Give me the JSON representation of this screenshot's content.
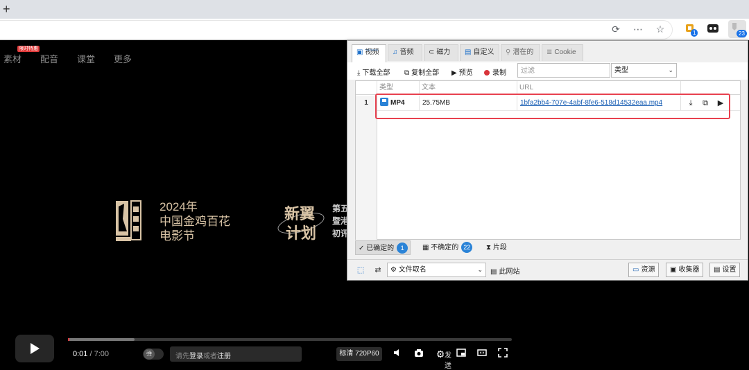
{
  "browser": {
    "newtab_glyph": "+",
    "ext_badge_1": "1",
    "ext_badge_2": "23"
  },
  "site": {
    "nav": [
      {
        "label": "素材",
        "hot": "限时特惠"
      },
      {
        "label": "配音"
      },
      {
        "label": "课堂"
      },
      {
        "label": "更多"
      }
    ],
    "hero_line1": "2024年",
    "hero_line2": "中国金鸡百花",
    "hero_line3": "电影节",
    "hero_side": "第五\n暨港\n初评"
  },
  "player": {
    "time_current": "0:01",
    "time_total": " / 7:00",
    "danmu_label": "弹",
    "comment_prefix": "请先",
    "comment_login": "登录",
    "comment_or": "或者",
    "comment_register": "注册",
    "send_label": "发送",
    "quality_label": "标清 720P60",
    "progress_played": 0.003,
    "progress_buffered": 0.15
  },
  "popup": {
    "tabs": [
      {
        "label": "视频",
        "icon": "save-icon",
        "glyph": "💾"
      },
      {
        "label": "音频",
        "icon": "music-icon",
        "glyph": "♫"
      },
      {
        "label": "磁力",
        "icon": "magnet-icon",
        "glyph": "⊂"
      },
      {
        "label": "自定义",
        "icon": "custom-icon",
        "glyph": "▤"
      },
      {
        "label": "潜在的",
        "icon": "potential-icon",
        "glyph": "⚲"
      },
      {
        "label": "Cookie",
        "icon": "cookie-icon",
        "glyph": "≣"
      }
    ],
    "actions": {
      "download_all": "下载全部",
      "copy_all": "复制全部",
      "preview": "预览",
      "record": "录制"
    },
    "filter_placeholder": "过滤",
    "type_select": "类型",
    "columns": {
      "type": "类型",
      "text": "文本",
      "url": "URL"
    },
    "rows": [
      {
        "index": "1",
        "type": "MP4",
        "text": "25.75MB",
        "url": "1bfa2bb4-707e-4abf-8fe6-518d14532eaa.mp4"
      }
    ],
    "status": {
      "confirmed_label": "已确定的",
      "confirmed_count": "1",
      "unconfirmed_label": "不确定的",
      "unconfirmed_count": "22",
      "segments_label": "片段"
    },
    "bottom": {
      "naming_select": "文件取名",
      "this_site": "此网站",
      "resources": "资源",
      "collector": "收集器",
      "settings": "设置"
    },
    "accent_color": "#2a83d7",
    "highlight_color": "#e8414f"
  }
}
